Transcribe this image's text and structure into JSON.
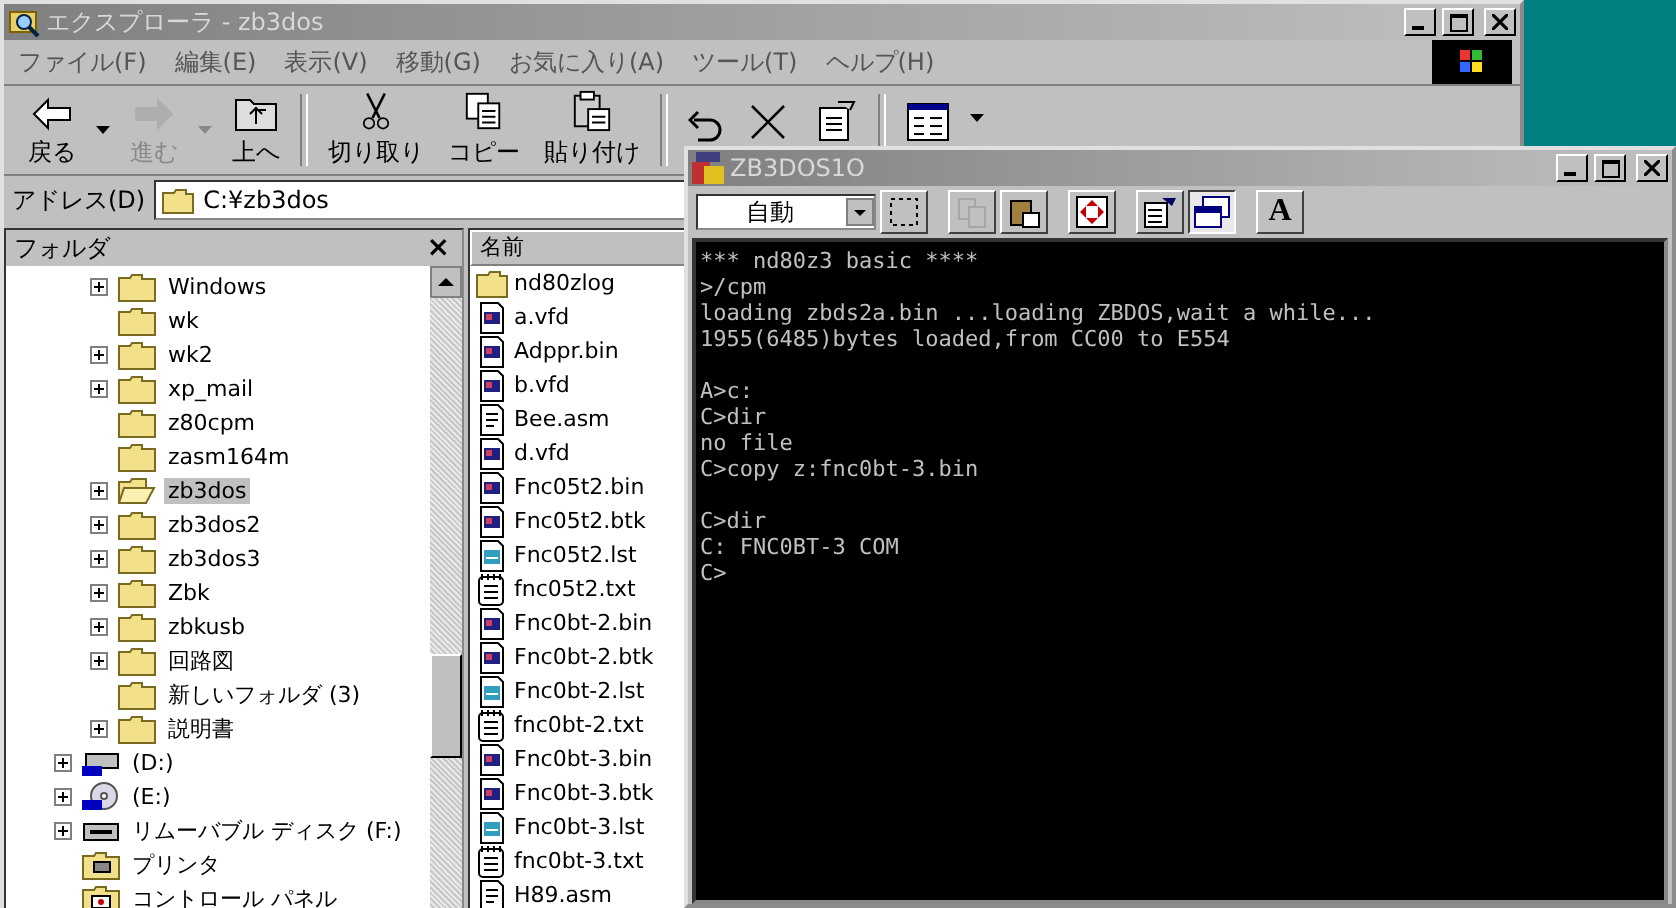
{
  "explorer": {
    "title": "エクスプローラ - zb3dos",
    "menu": [
      "ファイル(F)",
      "編集(E)",
      "表示(V)",
      "移動(G)",
      "お気に入り(A)",
      "ツール(T)",
      "ヘルプ(H)"
    ],
    "toolbar_groups": [
      [
        {
          "kind": "back",
          "label": "戻る",
          "dropdown": true,
          "disabled": false
        },
        {
          "kind": "forward",
          "label": "進む",
          "dropdown": true,
          "disabled": true
        },
        {
          "kind": "up",
          "label": "上へ",
          "disabled": false
        }
      ],
      [
        {
          "kind": "cut",
          "label": "切り取り",
          "disabled": false
        },
        {
          "kind": "copy",
          "label": "コピー",
          "disabled": false
        },
        {
          "kind": "paste",
          "label": "貼り付け",
          "disabled": false
        }
      ],
      [
        {
          "kind": "undo",
          "disabled": false
        },
        {
          "kind": "delete",
          "disabled": false
        },
        {
          "kind": "properties",
          "disabled": false
        }
      ],
      [
        {
          "kind": "views",
          "dropdown": true,
          "disabled": false
        }
      ]
    ],
    "address": {
      "label": "アドレス(D)",
      "value": "C:¥zb3dos"
    },
    "folder_pane": {
      "title": "フォルダ",
      "close": "×",
      "c_drive_children": [
        {
          "label": "Windows",
          "expandable": true,
          "selected": false
        },
        {
          "label": "wk",
          "expandable": false,
          "selected": false
        },
        {
          "label": "wk2",
          "expandable": true,
          "selected": false
        },
        {
          "label": "xp_mail",
          "expandable": true,
          "selected": false
        },
        {
          "label": "z80cpm",
          "expandable": false,
          "selected": false
        },
        {
          "label": "zasm164m",
          "expandable": false,
          "selected": false
        },
        {
          "label": "zb3dos",
          "expandable": true,
          "selected": true
        },
        {
          "label": "zb3dos2",
          "expandable": true,
          "selected": false
        },
        {
          "label": "zb3dos3",
          "expandable": true,
          "selected": false
        },
        {
          "label": "Zbk",
          "expandable": true,
          "selected": false
        },
        {
          "label": "zbkusb",
          "expandable": true,
          "selected": false
        },
        {
          "label": "回路図",
          "expandable": true,
          "selected": false
        },
        {
          "label": "新しいフォルダ (3)",
          "expandable": false,
          "selected": false
        },
        {
          "label": "説明書",
          "expandable": true,
          "selected": false
        }
      ],
      "items": [
        {
          "kind": "hdd",
          "label": "(D:)",
          "expandable": true,
          "selected": false
        },
        {
          "kind": "cdrom",
          "label": "(E:)",
          "expandable": true,
          "selected": false
        },
        {
          "kind": "removable",
          "label": "リムーバブル ディスク (F:)",
          "expandable": true,
          "selected": false
        },
        {
          "kind": "printer",
          "label": "プリンタ",
          "selected": false
        },
        {
          "kind": "control",
          "label": "コントロール パネル",
          "selected": false
        }
      ]
    },
    "file_list": {
      "column": "名前",
      "files": [
        {
          "kind": "folder",
          "name": "nd80zlog"
        },
        {
          "kind": "binary",
          "name": "a.vfd"
        },
        {
          "kind": "binary",
          "name": "Adppr.bin"
        },
        {
          "kind": "binary",
          "name": "b.vfd"
        },
        {
          "kind": "asm",
          "name": "Bee.asm"
        },
        {
          "kind": "binary",
          "name": "d.vfd"
        },
        {
          "kind": "binary",
          "name": "Fnc05t2.bin"
        },
        {
          "kind": "binary",
          "name": "Fnc05t2.btk"
        },
        {
          "kind": "listing",
          "name": "Fnc05t2.lst"
        },
        {
          "kind": "text",
          "name": "fnc05t2.txt"
        },
        {
          "kind": "binary",
          "name": "Fnc0bt-2.bin"
        },
        {
          "kind": "binary",
          "name": "Fnc0bt-2.btk"
        },
        {
          "kind": "listing",
          "name": "Fnc0bt-2.lst"
        },
        {
          "kind": "text",
          "name": "fnc0bt-2.txt"
        },
        {
          "kind": "binary",
          "name": "Fnc0bt-3.bin"
        },
        {
          "kind": "binary",
          "name": "Fnc0bt-3.btk"
        },
        {
          "kind": "listing",
          "name": "Fnc0bt-3.lst"
        },
        {
          "kind": "text",
          "name": "fnc0bt-3.txt"
        },
        {
          "kind": "asm",
          "name": "H89.asm"
        }
      ]
    }
  },
  "dos_window": {
    "title": "ZB3DOS1O",
    "font_select": "自動",
    "toolbar": [
      {
        "kind": "mark",
        "pressed": false,
        "disabled": false
      },
      {
        "kind": "copy",
        "pressed": false,
        "disabled": true
      },
      {
        "kind": "paste",
        "pressed": false,
        "disabled": false
      },
      {
        "kind": "fullscreen",
        "pressed": false,
        "disabled": false
      },
      {
        "kind": "properties",
        "pressed": false,
        "disabled": false
      },
      {
        "kind": "background",
        "pressed": true,
        "disabled": false
      },
      {
        "kind": "font",
        "label": "A",
        "pressed": false,
        "disabled": false
      }
    ],
    "console_blocks": [
      [
        "*** nd80z3 basic ****",
        ">/cpm",
        "loading zbds2a.bin ...loading ZBDOS,wait a while...",
        "1955(6485)bytes loaded,from CC00 to E554"
      ],
      [
        "A>c:",
        "C>dir",
        "no file",
        "C>copy z:fnc0bt-3.bin"
      ],
      [
        "C>dir",
        "C: FNC0BT-3 COM",
        "C>"
      ]
    ]
  }
}
